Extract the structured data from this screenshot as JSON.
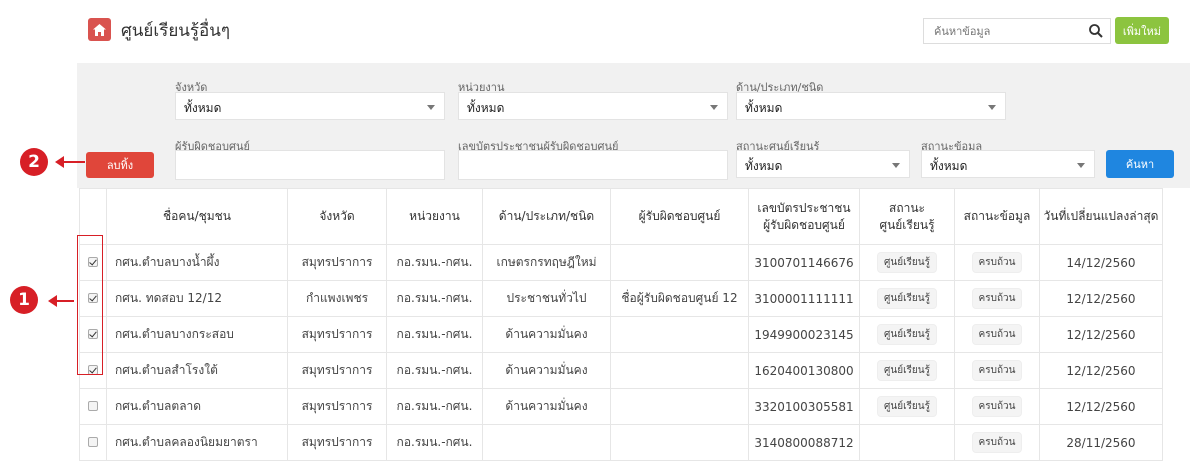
{
  "header": {
    "title": "ศูนย์เรียนรู้อื่นๆ",
    "search_placeholder": "ค้นหาข้อมูล",
    "add_label": "เพิ่มใหม่"
  },
  "filters": {
    "province": {
      "label": "จังหวัด",
      "value": "ทั้งหมด"
    },
    "unit": {
      "label": "หน่วยงาน",
      "value": "ทั้งหมด"
    },
    "type": {
      "label": "ด้าน/ประเภท/ชนิด",
      "value": "ทั้งหมด"
    },
    "responsible": {
      "label": "ผู้รับผิดชอบศูนย์"
    },
    "id_card": {
      "label": "เลขบัตรประชาชนผู้รับผิดชอบศูนย์"
    },
    "center_status": {
      "label": "สถานะศูนย์เรียนรู้",
      "value": "ทั้งหมด"
    },
    "data_status": {
      "label": "สถานะข้อมูล",
      "value": "ทั้งหมด"
    },
    "clear_label": "ลบทิ้ง",
    "search_label": "ค้นหา"
  },
  "table": {
    "headers": [
      "ชื่อคน/ชุมชน",
      "จังหวัด",
      "หน่วยงาน",
      "ด้าน/ประเภท/ชนิด",
      "ผู้รับผิดชอบศูนย์",
      "เลขบัตรประชาชน\nผู้รับผิดชอบศูนย์",
      "สถานะ\nศูนย์เรียนรู้",
      "สถานะข้อมูล",
      "วันที่เปลี่ยนแปลงล่าสุด"
    ],
    "rows": [
      {
        "checked": true,
        "name": "กศน.ตำบลบางน้ำผึ้ง",
        "province": "สมุทรปราการ",
        "unit": "กอ.รมน.-กศน.",
        "type": "เกษตรกรทฤษฎีใหม่",
        "responsible": "",
        "id": "3100701146676",
        "center_status": "ศูนย์เรียนรู้",
        "data_status": "ครบถ้วน",
        "date": "14/12/2560"
      },
      {
        "checked": true,
        "name": "กศน. ทดสอบ 12/12",
        "province": "กำแพงเพชร",
        "unit": "กอ.รมน.-กศน.",
        "type": "ประชาชนทั่วไป",
        "responsible": "ชื่อผู้รับผิดชอบศูนย์ 12",
        "id": "3100001111111",
        "center_status": "ศูนย์เรียนรู้",
        "data_status": "ครบถ้วน",
        "date": "12/12/2560"
      },
      {
        "checked": true,
        "name": "กศน.ตำบลบางกระสอบ",
        "province": "สมุทรปราการ",
        "unit": "กอ.รมน.-กศน.",
        "type": "ด้านความมั่นคง",
        "responsible": "",
        "id": "1949900023145",
        "center_status": "ศูนย์เรียนรู้",
        "data_status": "ครบถ้วน",
        "date": "12/12/2560"
      },
      {
        "checked": true,
        "name": "กศน.ตำบลสำโรงใต้",
        "province": "สมุทรปราการ",
        "unit": "กอ.รมน.-กศน.",
        "type": "ด้านความมั่นคง",
        "responsible": "",
        "id": "1620400130800",
        "center_status": "ศูนย์เรียนรู้",
        "data_status": "ครบถ้วน",
        "date": "12/12/2560"
      },
      {
        "checked": false,
        "name": "กศน.ตำบลตลาด",
        "province": "สมุทรปราการ",
        "unit": "กอ.รมน.-กศน.",
        "type": "ด้านความมั่นคง",
        "responsible": "",
        "id": "3320100305581",
        "center_status": "ศูนย์เรียนรู้",
        "data_status": "ครบถ้วน",
        "date": "12/12/2560"
      },
      {
        "checked": false,
        "name": "กศน.ตำบลคลองนิยมยาตรา",
        "province": "สมุทรปราการ",
        "unit": "กอ.รมน.-กศน.",
        "type": "",
        "responsible": "",
        "id": "3140800088712",
        "center_status": "",
        "data_status": "ครบถ้วน",
        "date": "28/11/2560"
      }
    ]
  },
  "annotations": {
    "one": "1",
    "two": "2"
  }
}
